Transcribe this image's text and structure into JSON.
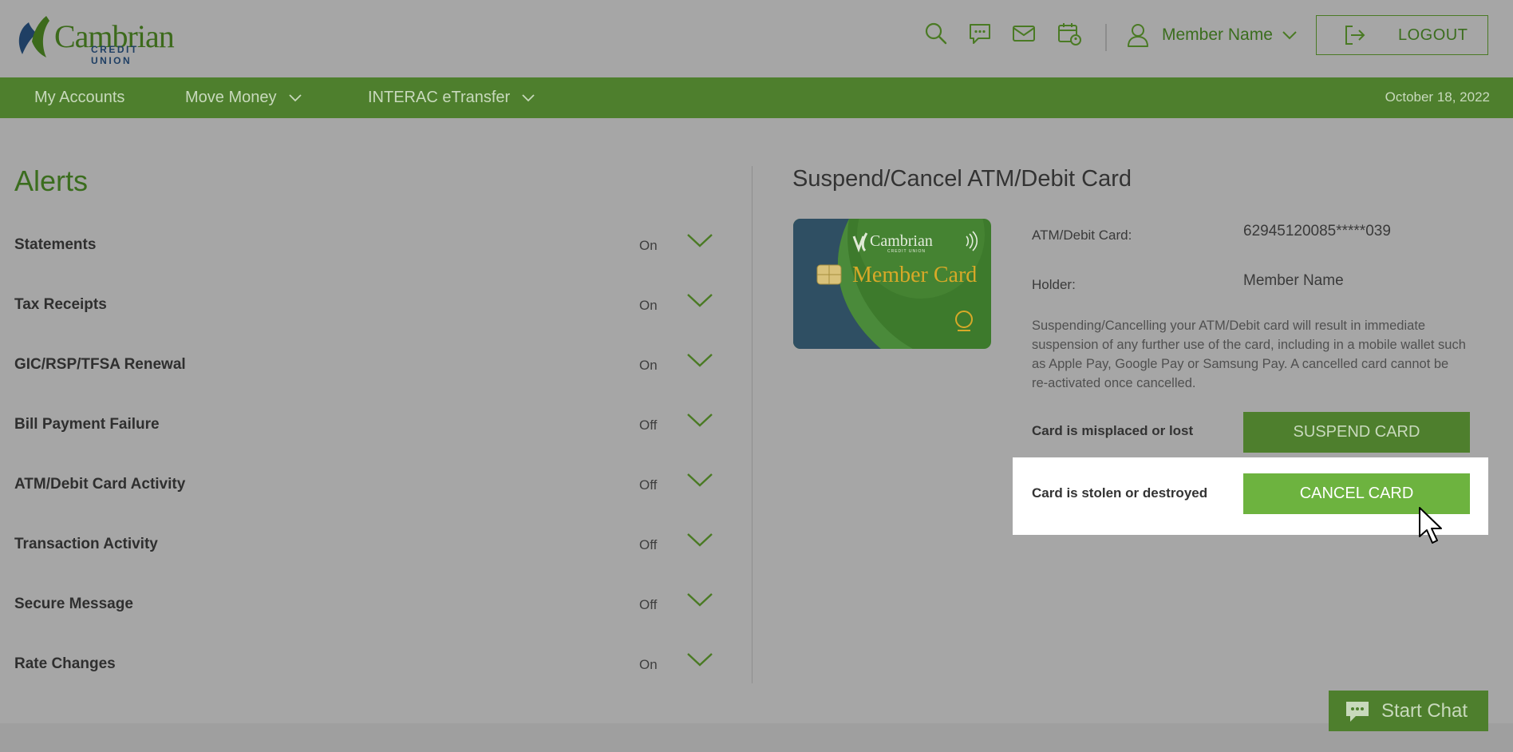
{
  "brand": {
    "logo_text": "Cambrian",
    "logo_sub": "CREDIT UNION",
    "primary": "#4e7f2d",
    "accent": "#6db33f"
  },
  "header": {
    "icons": [
      "search-icon",
      "chat-icon",
      "mail-icon",
      "calendar-icon"
    ],
    "member_name": "Member Name",
    "logout_label": "LOGOUT"
  },
  "nav": {
    "items": [
      {
        "label": "My Accounts"
      },
      {
        "label": "Move Money"
      },
      {
        "label": "INTERAC eTransfer"
      }
    ],
    "date": "October 18, 2022"
  },
  "alerts": {
    "title": "Alerts",
    "items": [
      {
        "name": "Statements",
        "status": "On"
      },
      {
        "name": "Tax Receipts",
        "status": "On"
      },
      {
        "name": "GIC/RSP/TFSA Renewal",
        "status": "On"
      },
      {
        "name": "Bill Payment Failure",
        "status": "Off"
      },
      {
        "name": "ATM/Debit Card Activity",
        "status": "Off"
      },
      {
        "name": "Transaction Activity",
        "status": "Off"
      },
      {
        "name": "Secure Message",
        "status": "Off"
      },
      {
        "name": "Rate Changes",
        "status": "On"
      }
    ]
  },
  "card_panel": {
    "title": "Suspend/Cancel ATM/Debit Card",
    "card_image": {
      "brand": "Cambrian",
      "brand_sub": "CREDIT UNION",
      "name": "Member Card"
    },
    "card_label": "ATM/Debit Card:",
    "card_number": "62945120085*****039",
    "holder_label": "Holder:",
    "holder_name": "Member Name",
    "description": "Suspending/Cancelling your ATM/Debit card will result in immediate suspension of any further use of the card, including in a mobile wallet such as Apple Pay, Google Pay or Samsung Pay. A cancelled card cannot be re-activated once cancelled.",
    "lost_label": "Card is misplaced or lost",
    "suspend_label": "SUSPEND CARD",
    "stolen_label": "Card is stolen or destroyed",
    "cancel_label": "CANCEL CARD"
  },
  "chat": {
    "label": "Start Chat"
  }
}
